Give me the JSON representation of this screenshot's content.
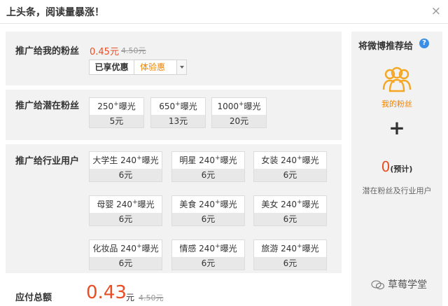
{
  "header": {
    "title": "上头条，阅读量暴涨！",
    "close_label": "×"
  },
  "my_fans": {
    "title": "推广给我的粉丝",
    "price_now": "0.45元",
    "price_old": "4.50元",
    "discount_button": "已享优惠",
    "discount_tag": "体验惠"
  },
  "potential_fans": {
    "title": "推广给潜在粉丝",
    "options": [
      {
        "count": "250",
        "plus": "+",
        "unit": "曝光",
        "price": "5元"
      },
      {
        "count": "650",
        "plus": "+",
        "unit": "曝光",
        "price": "13元"
      },
      {
        "count": "1000",
        "plus": "+",
        "unit": "曝光",
        "price": "20元"
      }
    ]
  },
  "industry": {
    "title": "推广给行业用户",
    "options": [
      {
        "name": "大学生 240",
        "plus": "+",
        "unit": "曝光",
        "price": "6元"
      },
      {
        "name": "明星 240",
        "plus": "+",
        "unit": "曝光",
        "price": "6元"
      },
      {
        "name": "女装 240",
        "plus": "+",
        "unit": "曝光",
        "price": "6元"
      },
      {
        "name": "母婴 240",
        "plus": "+",
        "unit": "曝光",
        "price": "6元"
      },
      {
        "name": "美食 240",
        "plus": "+",
        "unit": "曝光",
        "price": "6元"
      },
      {
        "name": "美女 240",
        "plus": "+",
        "unit": "曝光",
        "price": "6元"
      },
      {
        "name": "化妆品 240",
        "plus": "+",
        "unit": "曝光",
        "price": "6元"
      },
      {
        "name": "情感 240",
        "plus": "+",
        "unit": "曝光",
        "price": "6元"
      },
      {
        "name": "旅游 240",
        "plus": "+",
        "unit": "曝光",
        "price": "6元"
      }
    ]
  },
  "total": {
    "label": "应付总额",
    "amount": "0.43",
    "unit": "元",
    "old": "4.50元"
  },
  "recommend": {
    "title": "将微博推荐给",
    "help_icon": "question-circle-icon",
    "help_glyph": "?",
    "fans_icon": "users-icon",
    "fans_label": "我的粉丝",
    "plus": "+",
    "estimate_value": "0",
    "estimate_suffix": "(预计)",
    "potential_label": "潜在粉丝及行业用户"
  },
  "watermark": {
    "icon": "wechat-icon",
    "text": "草莓学堂"
  },
  "colors": {
    "accent": "#e94e24",
    "orange": "#f08300",
    "panel": "#f2f2f2",
    "help": "#3a8ee6"
  }
}
